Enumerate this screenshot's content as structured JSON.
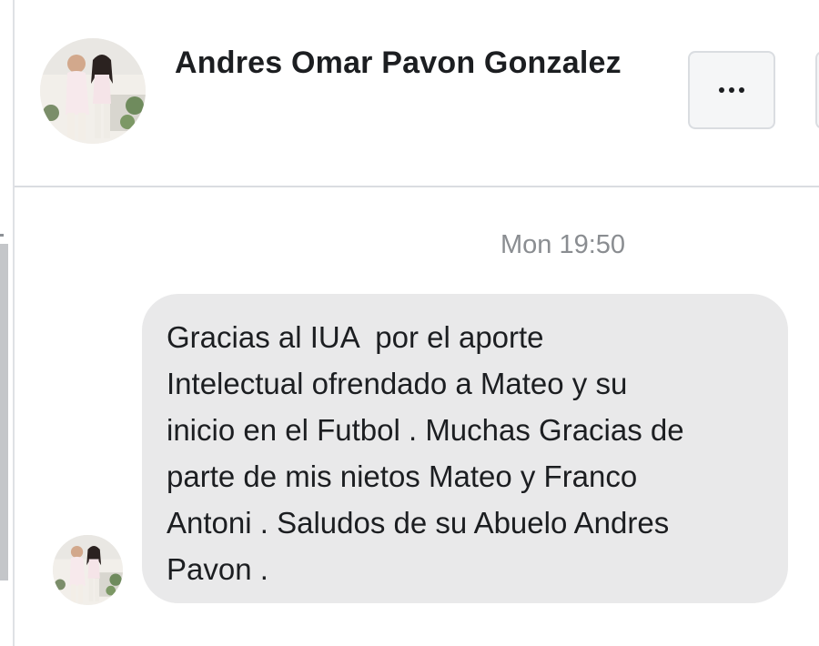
{
  "header": {
    "contact_name": "Andres Omar Pavon Gonzalez",
    "more_button_icon": "more-horizontal-icon"
  },
  "conversation": {
    "timestamp": "Mon 19:50",
    "message": {
      "lines": [
        "Gracias al IUA  por el aporte",
        "Intelectual ofrendado a Mateo y su",
        "inicio en el Futbol . Muchas Gracias de",
        "parte de mis nietos Mateo y Franco",
        "Antoni . Saludos de su Abuelo Andres",
        "Pavon ."
      ]
    }
  },
  "colors": {
    "bubble_background": "#e9e9ea",
    "text": "#1c1e21",
    "timestamp": "#8a8d91",
    "divider": "#dadde1"
  }
}
